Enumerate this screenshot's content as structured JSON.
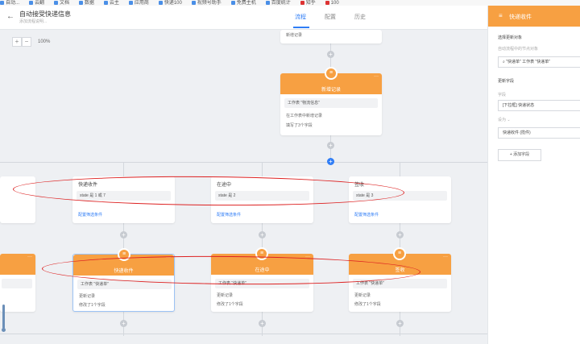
{
  "bookmarks": [
    "自动...",
    "云翻",
    "文档",
    "数据",
    "云主",
    "应用商",
    "快递100",
    "视频号助手",
    "免费主机",
    "百度统计",
    "知乎",
    "100"
  ],
  "header": {
    "back_icon": "arrow-left-icon",
    "title": "自动接受快递信息",
    "subtitle": "添加流程说明...",
    "tabs": [
      {
        "label": "流程",
        "active": true
      },
      {
        "label": "配置",
        "active": false
      },
      {
        "label": "历史",
        "active": false
      }
    ]
  },
  "zoom": {
    "minus": "−",
    "plus": "+",
    "value": "100%"
  },
  "top_card": {
    "fragment": "新增记录"
  },
  "new_record": {
    "title": "新增记录",
    "more": "···",
    "field": "工作表 \"物流信息\"",
    "line1": "在工作表中新增记录",
    "line2": "填写了3个字段"
  },
  "branches": [
    {
      "title": "快递收件",
      "field": "state 是 1 或 7",
      "link": "配置筛选条件",
      "node_title": "快递收件",
      "node_field": "工作表 \"快递单\"",
      "node_line1": "更新记录",
      "node_line2": "修改了1个字段"
    },
    {
      "title": "在途中",
      "field": "state 是 2",
      "link": "配置筛选条件",
      "node_title": "在途中",
      "node_field": "工作表 \"快递单\"",
      "node_line1": "更新记录",
      "node_line2": "修改了1个字段"
    },
    {
      "title": "签收",
      "field": "state 是 3",
      "link": "配置筛选条件",
      "node_title": "签收",
      "node_field": "工作表 \"快递单\"",
      "node_line1": "更新记录",
      "node_line2": "修改了1个字段"
    }
  ],
  "panel": {
    "title": "快递收件",
    "section1": "选择更新对象",
    "hint1": "自动流程中的节点对象",
    "object_value": "\"快递单\" 工作表 \"快递单\"",
    "section2": "更新字段",
    "field_label": "字段",
    "field_value": "[下拉框] 快递状态",
    "set_label": "设为 ⌄",
    "set_value": "快递收件 (揽件)",
    "add_button": "+ 添加字段"
  },
  "colors": {
    "accent": "#2f7df6",
    "node_orange": "#f7a042",
    "annotation_red": "#d22222"
  }
}
